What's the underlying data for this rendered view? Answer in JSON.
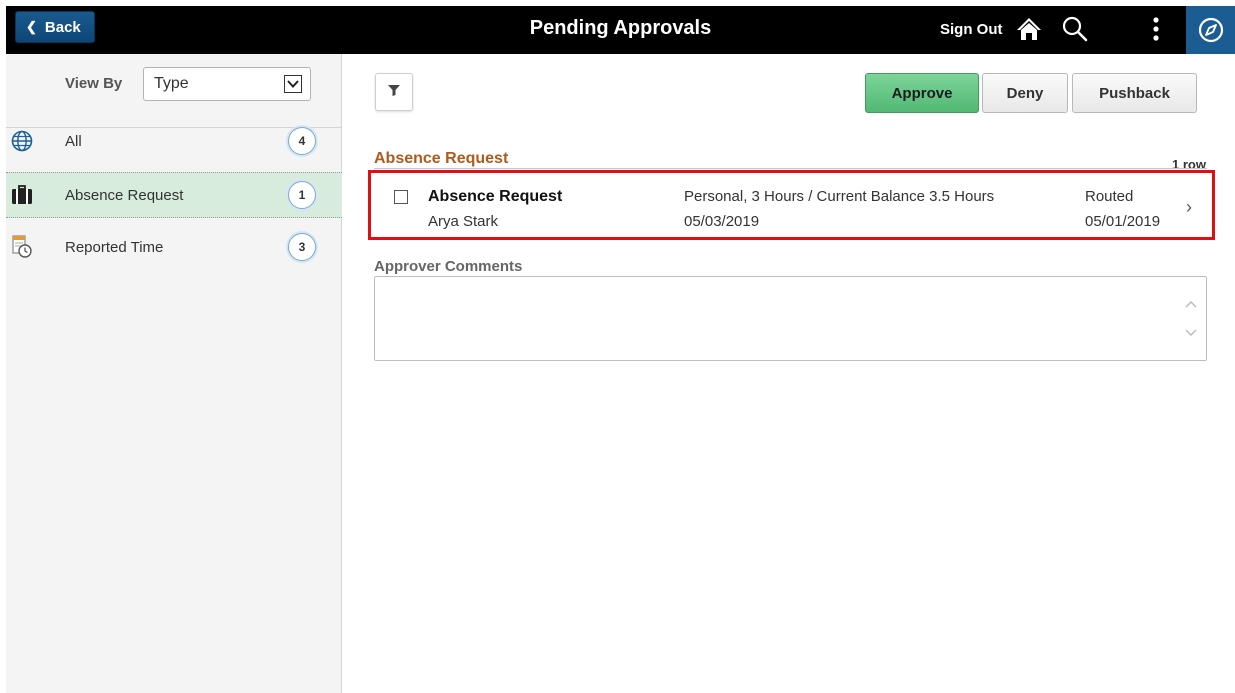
{
  "header": {
    "back_label": "Back",
    "title": "Pending Approvals",
    "sign_out_label": "Sign Out",
    "icons": [
      "home-icon",
      "search-icon",
      "more-options-icon",
      "navbar-compass-icon"
    ]
  },
  "sidebar": {
    "view_by_label": "View By",
    "view_by_selected": "Type",
    "items": [
      {
        "label": "All",
        "count": "4",
        "icon": "globe-icon"
      },
      {
        "label": "Absence Request",
        "count": "1",
        "icon": "briefcase-icon",
        "active": true
      },
      {
        "label": "Reported Time",
        "count": "3",
        "icon": "timesheet-clock-icon"
      }
    ]
  },
  "actions": {
    "approve_label": "Approve",
    "deny_label": "Deny",
    "pushback_label": "Pushback"
  },
  "section": {
    "title": "Absence Request",
    "row_count": "1 row"
  },
  "request": {
    "type": "Absence Request",
    "name": "Arya Stark",
    "detail": "Personal, 3 Hours / Current Balance 3.5 Hours",
    "date": "05/03/2019",
    "status": "Routed",
    "status_date": "05/01/2019"
  },
  "comments": {
    "label": "Approver Comments",
    "value": ""
  },
  "colors": {
    "header_bg": "#000000",
    "back_button": "#0d4676",
    "approve_button": "#52b874",
    "section_title": "#b05a1e",
    "active_item_bg": "#d7ecdc",
    "highlight_border": "#e01010"
  }
}
